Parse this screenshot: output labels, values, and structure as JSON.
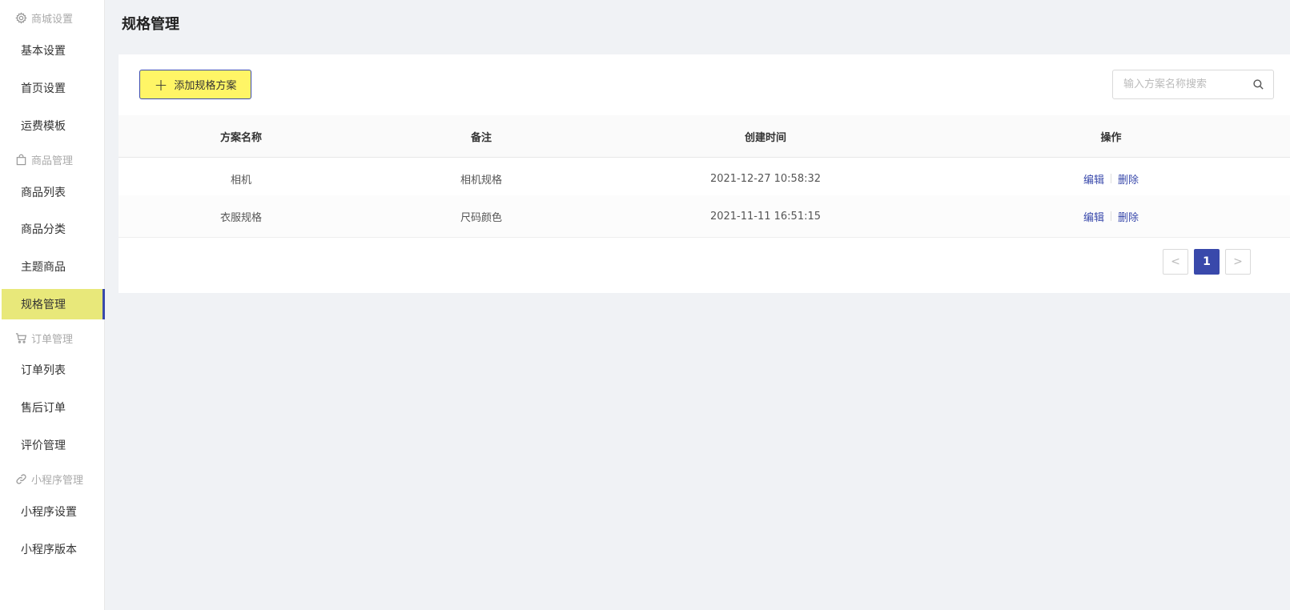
{
  "sidebar": {
    "groups": [
      {
        "title": "商城设置",
        "icon": "gear-icon",
        "items": [
          "基本设置",
          "首页设置",
          "运费模板"
        ]
      },
      {
        "title": "商品管理",
        "icon": "bag-icon",
        "items": [
          "商品列表",
          "商品分类",
          "主题商品",
          "规格管理"
        ]
      },
      {
        "title": "订单管理",
        "icon": "cart-icon",
        "items": [
          "订单列表",
          "售后订单",
          "评价管理"
        ]
      },
      {
        "title": "小程序管理",
        "icon": "link-icon",
        "items": [
          "小程序设置",
          "小程序版本"
        ]
      }
    ],
    "active_item": "规格管理"
  },
  "page": {
    "title": "规格管理"
  },
  "toolbar": {
    "add_label": "添加规格方案",
    "search_placeholder": "输入方案名称搜索"
  },
  "table": {
    "columns": [
      "方案名称",
      "备注",
      "创建时间",
      "操作"
    ],
    "rows": [
      {
        "name": "相机",
        "note": "相机规格",
        "created": "2021-12-27 10:58:32",
        "edit": "编辑",
        "delete": "删除"
      },
      {
        "name": "衣服规格",
        "note": "尺码颜色",
        "created": "2021-11-11 16:51:15",
        "edit": "编辑",
        "delete": "删除"
      }
    ]
  },
  "pagination": {
    "prev": "<",
    "current": "1",
    "next": ">"
  },
  "colors": {
    "accent": "#3949ab",
    "highlight": "#fff566",
    "active_nav": "#e8e87a"
  }
}
